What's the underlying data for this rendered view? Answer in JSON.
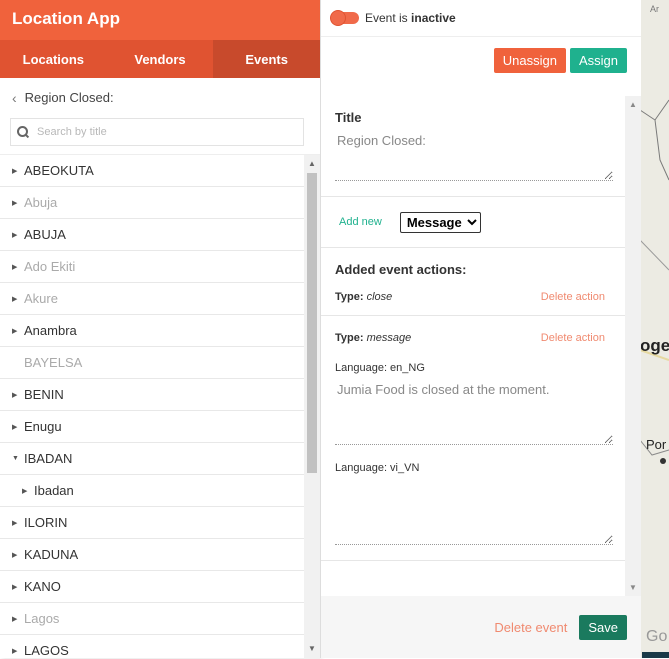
{
  "app": {
    "title": "Location App"
  },
  "tabs": [
    {
      "label": "Locations"
    },
    {
      "label": "Vendors"
    },
    {
      "label": "Events"
    }
  ],
  "breadcrumb": {
    "label": "Region Closed:"
  },
  "search": {
    "placeholder": "Search by title"
  },
  "regions": [
    {
      "label": "ABEOKUTA",
      "dim": false,
      "arrow": "right"
    },
    {
      "label": "Abuja",
      "dim": true,
      "arrow": "right"
    },
    {
      "label": "ABUJA",
      "dim": false,
      "arrow": "right"
    },
    {
      "label": "Ado Ekiti",
      "dim": true,
      "arrow": "right"
    },
    {
      "label": "Akure",
      "dim": true,
      "arrow": "right"
    },
    {
      "label": "Anambra",
      "dim": false,
      "arrow": "right"
    },
    {
      "label": "BAYELSA",
      "dim": true,
      "arrow": "none"
    },
    {
      "label": "BENIN",
      "dim": false,
      "arrow": "right"
    },
    {
      "label": "Enugu",
      "dim": false,
      "arrow": "right"
    },
    {
      "label": "IBADAN",
      "dim": false,
      "arrow": "down"
    },
    {
      "label": "Ibadan",
      "dim": false,
      "arrow": "right",
      "child": true
    },
    {
      "label": "ILORIN",
      "dim": false,
      "arrow": "right"
    },
    {
      "label": "KADUNA",
      "dim": false,
      "arrow": "right"
    },
    {
      "label": "KANO",
      "dim": false,
      "arrow": "right"
    },
    {
      "label": "Lagos",
      "dim": true,
      "arrow": "right"
    },
    {
      "label": "LAGOS",
      "dim": false,
      "arrow": "right"
    }
  ],
  "event": {
    "status_prefix": "Event is ",
    "status_value": "inactive",
    "unassign_label": "Unassign",
    "assign_label": "Assign",
    "title_heading": "Title",
    "title_value": "Region Closed:",
    "add_new_label": "Add new",
    "action_type_options": [
      "Message"
    ],
    "actions_heading": "Added event actions:",
    "type_label": "Type:",
    "delete_action_label": "Delete action",
    "actions": [
      {
        "type": "close"
      },
      {
        "type": "message"
      }
    ],
    "languages": [
      {
        "label": "Language: en_NG",
        "text": "Jumia Food is closed at the moment."
      },
      {
        "label": "Language: vi_VN",
        "text": ""
      }
    ],
    "delete_event_label": "Delete event",
    "save_label": "Save"
  },
  "map": {
    "labels": [
      "Ar",
      "oge",
      "Por",
      "Go"
    ]
  },
  "colors": {
    "header": "#f0623c",
    "tabs": "#e05331",
    "tab_active": "#c84a2c",
    "assign": "#1fb18e",
    "save": "#1a7a5e"
  }
}
